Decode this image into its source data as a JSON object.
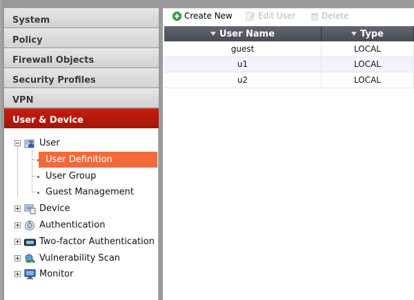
{
  "nav": {
    "sections": [
      "System",
      "Policy",
      "Firewall Objects",
      "Security Profiles",
      "VPN",
      "User & Device"
    ],
    "active": "User & Device"
  },
  "tree": {
    "user": "User",
    "user_children": [
      "User Definition",
      "User Group",
      "Guest Management"
    ],
    "selected": "User Definition",
    "others": [
      "Device",
      "Authentication",
      "Two-factor Authentication",
      "Vulnerability Scan",
      "Monitor"
    ]
  },
  "toolbar": {
    "create": "Create New",
    "edit": "Edit User",
    "delete": "Delete"
  },
  "table": {
    "columns": [
      "User Name",
      "Type"
    ],
    "rows": [
      [
        "guest",
        "LOCAL"
      ],
      [
        "u1",
        "LOCAL"
      ],
      [
        "u2",
        "LOCAL"
      ]
    ]
  }
}
